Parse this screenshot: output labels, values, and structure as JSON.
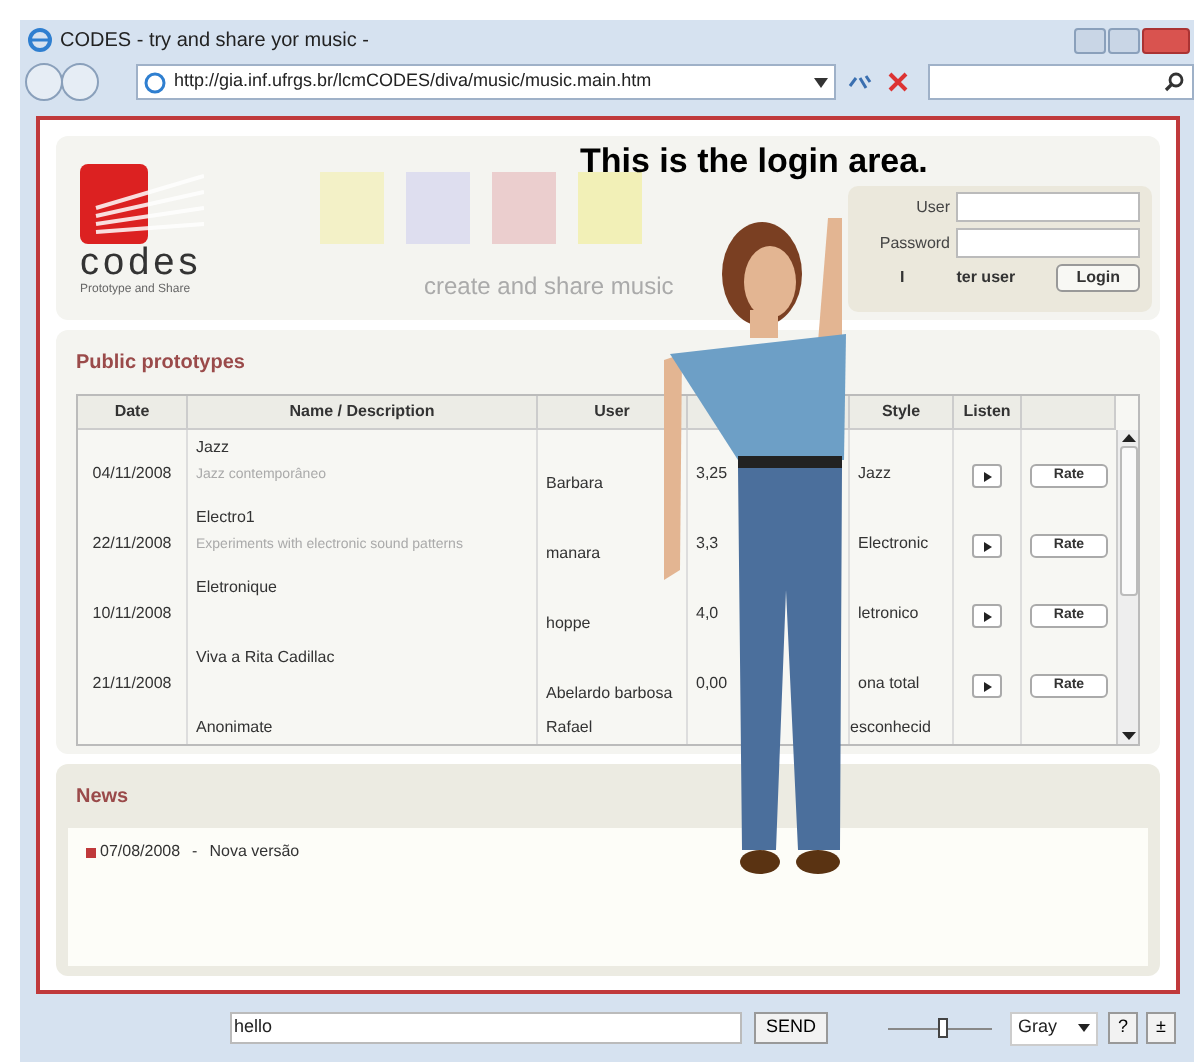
{
  "window": {
    "title": "CODES - try and share yor music -"
  },
  "address_bar": {
    "url": "http://gia.inf.ufrgs.br/lcmCODES/diva/music/music.main.htm"
  },
  "header": {
    "logo_text": "codes",
    "logo_subtitle": "Prototype and Share",
    "tagline": "create and share music",
    "annotation": "This is the login area."
  },
  "login": {
    "user_label": "User",
    "password_label": "Password",
    "register_fragments": [
      "I",
      "ter user"
    ],
    "login_button": "Login"
  },
  "prototypes": {
    "title": "Public prototypes",
    "columns": [
      "Date",
      "Name / Description",
      "User",
      "Style",
      "Listen"
    ],
    "rows": [
      {
        "date": "04/11/2008",
        "name": "Jazz",
        "description": "Jazz contemporâneo",
        "user": "Barbara",
        "rating": "3,25",
        "style": "Jazz",
        "rate_label": "Rate"
      },
      {
        "date": "22/11/2008",
        "name": "Electro1",
        "description": "Experiments with electronic sound patterns",
        "user": "manara",
        "rating": "3,3",
        "style": "Electronic",
        "rate_label": "Rate"
      },
      {
        "date": "10/11/2008",
        "name": "Eletronique",
        "user": "hoppe",
        "rating": "4,0",
        "style": "letronico",
        "rate_label": "Rate"
      },
      {
        "date": "21/11/2008",
        "name": "Viva a Rita Cadillac",
        "user": "Abelardo barbosa",
        "rating": "0,00",
        "style": "ona total",
        "rate_label": "Rate"
      },
      {
        "name": "Anonimate",
        "user": "Rafael",
        "style": "esconhecid"
      }
    ]
  },
  "news": {
    "title": "News",
    "items": [
      {
        "date": "07/08/2008",
        "separator": "-",
        "text": "Nova versão"
      }
    ]
  },
  "bottom_bar": {
    "chat_input": {
      "value": "hello"
    },
    "send_button": "SEND",
    "slider": {
      "level": 0.53
    },
    "select": {
      "value": "Gray"
    },
    "help_button": "?",
    "plus_minus_button": "±"
  }
}
